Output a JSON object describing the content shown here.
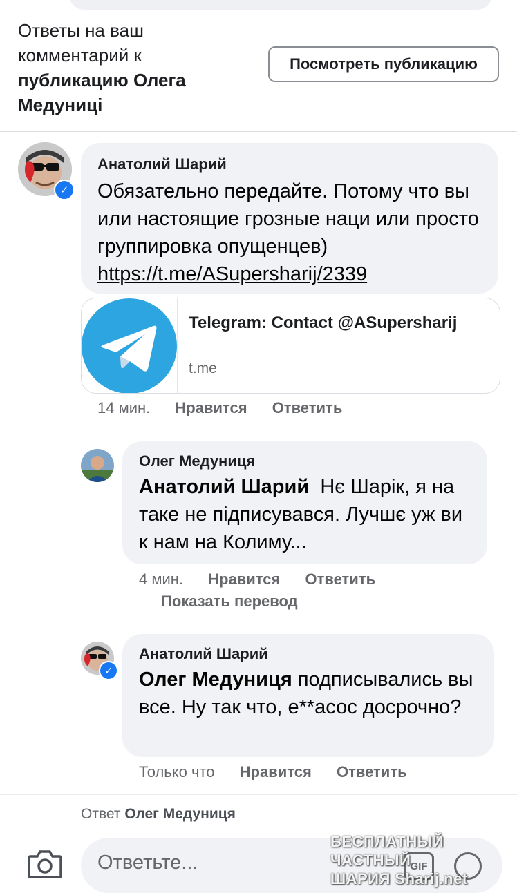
{
  "header": {
    "title_prefix": "Ответы на ваш комментарий к",
    "title_bold": "публикацию Олега Медуниці",
    "view_button": "Посмотреть публикацию"
  },
  "comments": [
    {
      "author": "Анатолий Шарий",
      "text": "Обязательно передайте. Потому что вы или настоящие грозные наци или просто группировка опущенцев)",
      "link": "https://t.me/ASupersharij/2339",
      "preview": {
        "title": "Telegram: Contact @ASupersharij",
        "domain": "t.me"
      },
      "time": "14 мин.",
      "like": "Нравится",
      "reply": "Ответить"
    },
    {
      "author": "Олег Медуниця",
      "mention": "Анатолий Шарий",
      "text": "Нє Шарік, я на таке не підписувався. Лучшє уж ви к нам на Колиму...",
      "time": "4 мин.",
      "like": "Нравится",
      "reply": "Ответить",
      "translate": "Показать перевод"
    },
    {
      "author": "Анатолий Шарий",
      "mention": "Олег Медуниця",
      "text": "подписывались вы все. Ну так что, е**асос досрочно?",
      "time": "Только что",
      "like": "Нравится",
      "reply": "Ответить"
    }
  ],
  "composer": {
    "reply_label": "Ответ",
    "reply_name": "Олег Медуниця",
    "placeholder": "Ответьте...",
    "gif_label": "GIF"
  },
  "watermark": {
    "line1": "БЕСПЛАТНЫЙ ЧАСТНЫЙ",
    "line2": "ШАРИЯ Sharij.net"
  },
  "icons": {
    "camera": "camera-icon",
    "gif": "gif-icon",
    "emoji": "emoji-icon",
    "verified": "verified-badge-icon",
    "telegram": "telegram-logo"
  },
  "colors": {
    "bubble": "#f0f2f5",
    "secondary_text": "#65676b",
    "verified_blue": "#1877f2",
    "telegram_blue": "#2ca5e0"
  }
}
